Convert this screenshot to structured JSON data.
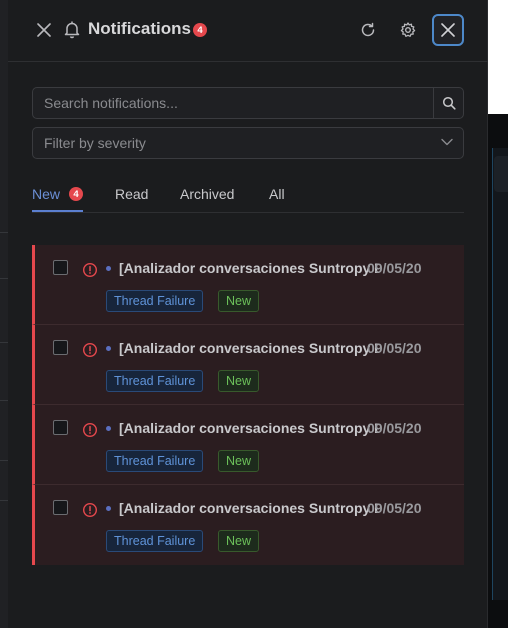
{
  "header": {
    "title": "Notifications",
    "badge_count": "4"
  },
  "search": {
    "placeholder": "Search notifications..."
  },
  "filter": {
    "placeholder": "Filter by severity"
  },
  "tabs": [
    {
      "label": "New",
      "badge": "4",
      "active": true
    },
    {
      "label": "Read",
      "active": false
    },
    {
      "label": "Archived",
      "active": false
    },
    {
      "label": "All",
      "active": false
    }
  ],
  "notifications": [
    {
      "title": "[Analizador conversaciones Suntropy DEV] - Ex",
      "date": "09/05/20",
      "type": "Thread Failure",
      "status": "New",
      "severity_color": "#e5484d"
    },
    {
      "title": "[Analizador conversaciones Suntropy DEV] - Ex",
      "date": "09/05/20",
      "type": "Thread Failure",
      "status": "New",
      "severity_color": "#e5484d"
    },
    {
      "title": "[Analizador conversaciones Suntropy DEV] - Ex",
      "date": "09/05/20",
      "type": "Thread Failure",
      "status": "New",
      "severity_color": "#e5484d"
    },
    {
      "title": "[Analizador conversaciones Suntropy DEV] - Ex",
      "date": "09/05/20",
      "type": "Thread Failure",
      "status": "New",
      "severity_color": "#e5484d"
    }
  ],
  "colors": {
    "accent": "#6b8fd6",
    "danger": "#e5484d",
    "tag_blue": "#5f93d8",
    "tag_green": "#6cc15a"
  },
  "icons": [
    "close-icon",
    "bell-icon",
    "refresh-icon",
    "gear-icon",
    "search-icon",
    "chevron-down-icon",
    "alert-circle-icon"
  ]
}
